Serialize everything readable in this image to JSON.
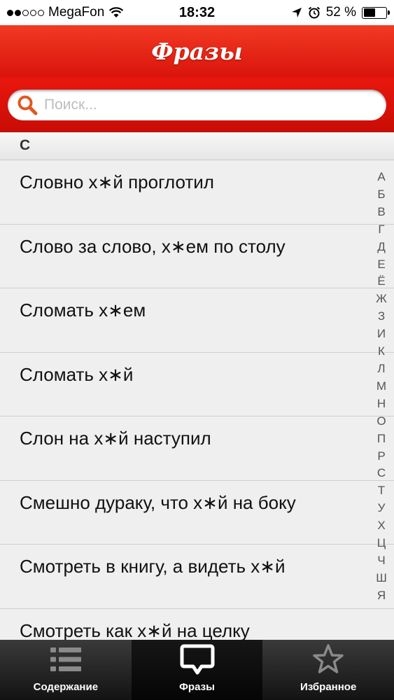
{
  "status_bar": {
    "carrier": "MegaFon",
    "time": "18:32",
    "battery": "52 %",
    "battery_level": 52
  },
  "header": {
    "title": "Фразы"
  },
  "search": {
    "placeholder": "Поиск..."
  },
  "section": {
    "letter": "С"
  },
  "phrases": [
    "Словно х∗й проглотил",
    "Слово за слово, х∗ем по столу",
    "Сломать х∗ем",
    "Сломать х∗й",
    "Слон на х∗й наступил",
    "Смешно дураку, что х∗й на боку",
    "Смотреть в книгу, а видеть х∗й",
    "Смотреть как х∗й на целку"
  ],
  "alphabet_index": [
    "А",
    "Б",
    "В",
    "Г",
    "Д",
    "Е",
    "Ё",
    "Ж",
    "З",
    "И",
    "К",
    "Л",
    "М",
    "Н",
    "О",
    "П",
    "Р",
    "С",
    "Т",
    "У",
    "Х",
    "Ц",
    "Ч",
    "Ш",
    "Я"
  ],
  "tabs": [
    {
      "label": "Содержание",
      "icon": "list-icon",
      "active": false
    },
    {
      "label": "Фразы",
      "icon": "speech-bubble-icon",
      "active": true
    },
    {
      "label": "Избранное",
      "icon": "star-icon",
      "active": false
    }
  ]
}
